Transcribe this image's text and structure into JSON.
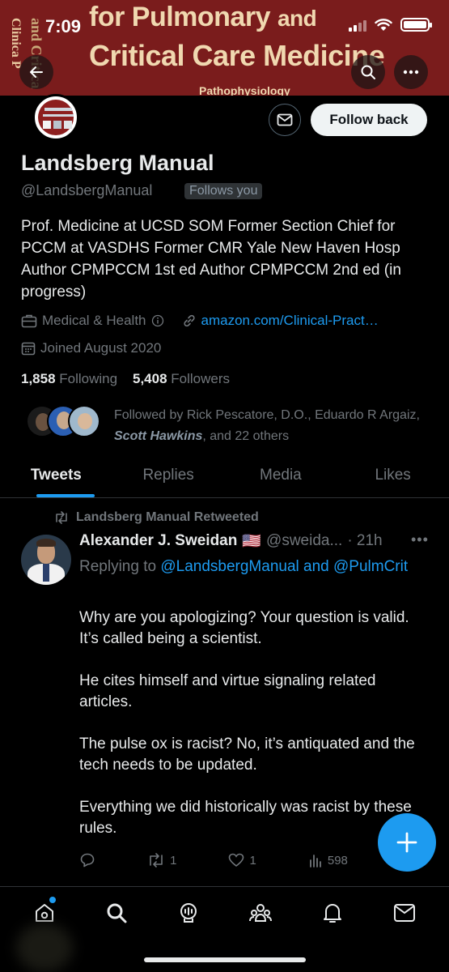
{
  "status_bar": {
    "time": "7:09"
  },
  "banner": {
    "side_text_1": "Clinica P",
    "side_text_2": "and Critica",
    "line1_pre": "for Pulmonary",
    "line1_and": "and",
    "line2": "Critical Care Medicine",
    "line3": "Pathophysiology"
  },
  "profile": {
    "name": "Landsberg Manual",
    "handle": "@LandsbergManual",
    "follows_you": "Follows you",
    "follow_button": "Follow back",
    "bio": "Prof. Medicine at UCSD SOM Former Section Chief for PCCM at VASDHS Former CMR Yale New Haven Hosp Author CPMPCCM 1st ed Author CPMPCCM 2nd ed (in progress)",
    "category": "Medical & Health",
    "link": "amazon.com/Clinical-Pract…",
    "joined": "Joined August 2020",
    "following_count": "1,858",
    "following_label": "Following",
    "followers_count": "5,408",
    "followers_label": "Followers",
    "followed_by_pre": "Followed by Rick Pescatore, D.O., Eduardo R Argaiz, ",
    "followed_by_em": "Scott Hawkins",
    "followed_by_post": ", and 22 others"
  },
  "tabs": [
    {
      "label": "Tweets"
    },
    {
      "label": "Replies"
    },
    {
      "label": "Media"
    },
    {
      "label": "Likes"
    }
  ],
  "tweet": {
    "retweeted_by": "Landsberg Manual Retweeted",
    "author_name": "Alexander J. Sweidan",
    "flag": "🇺🇸",
    "author_handle": "@sweida...",
    "time": "· 21h",
    "replying_prefix": "Replying to ",
    "replying_to": "@LandsbergManual and @PulmCrit",
    "text": "Why are you apologizing? Your question is valid. It’s called being a scientist.\n\nHe cites himself and virtue signaling related articles.\n\nThe pulse ox is racist? No, it’s antiquated and the tech needs to be updated.\n\nEverything we did historically was racist by these rules.",
    "retweets": "1",
    "likes": "1",
    "views": "598"
  },
  "colors": {
    "accent": "#1d9bf0",
    "banner": "#7a1c1c",
    "muted": "#71767b"
  }
}
